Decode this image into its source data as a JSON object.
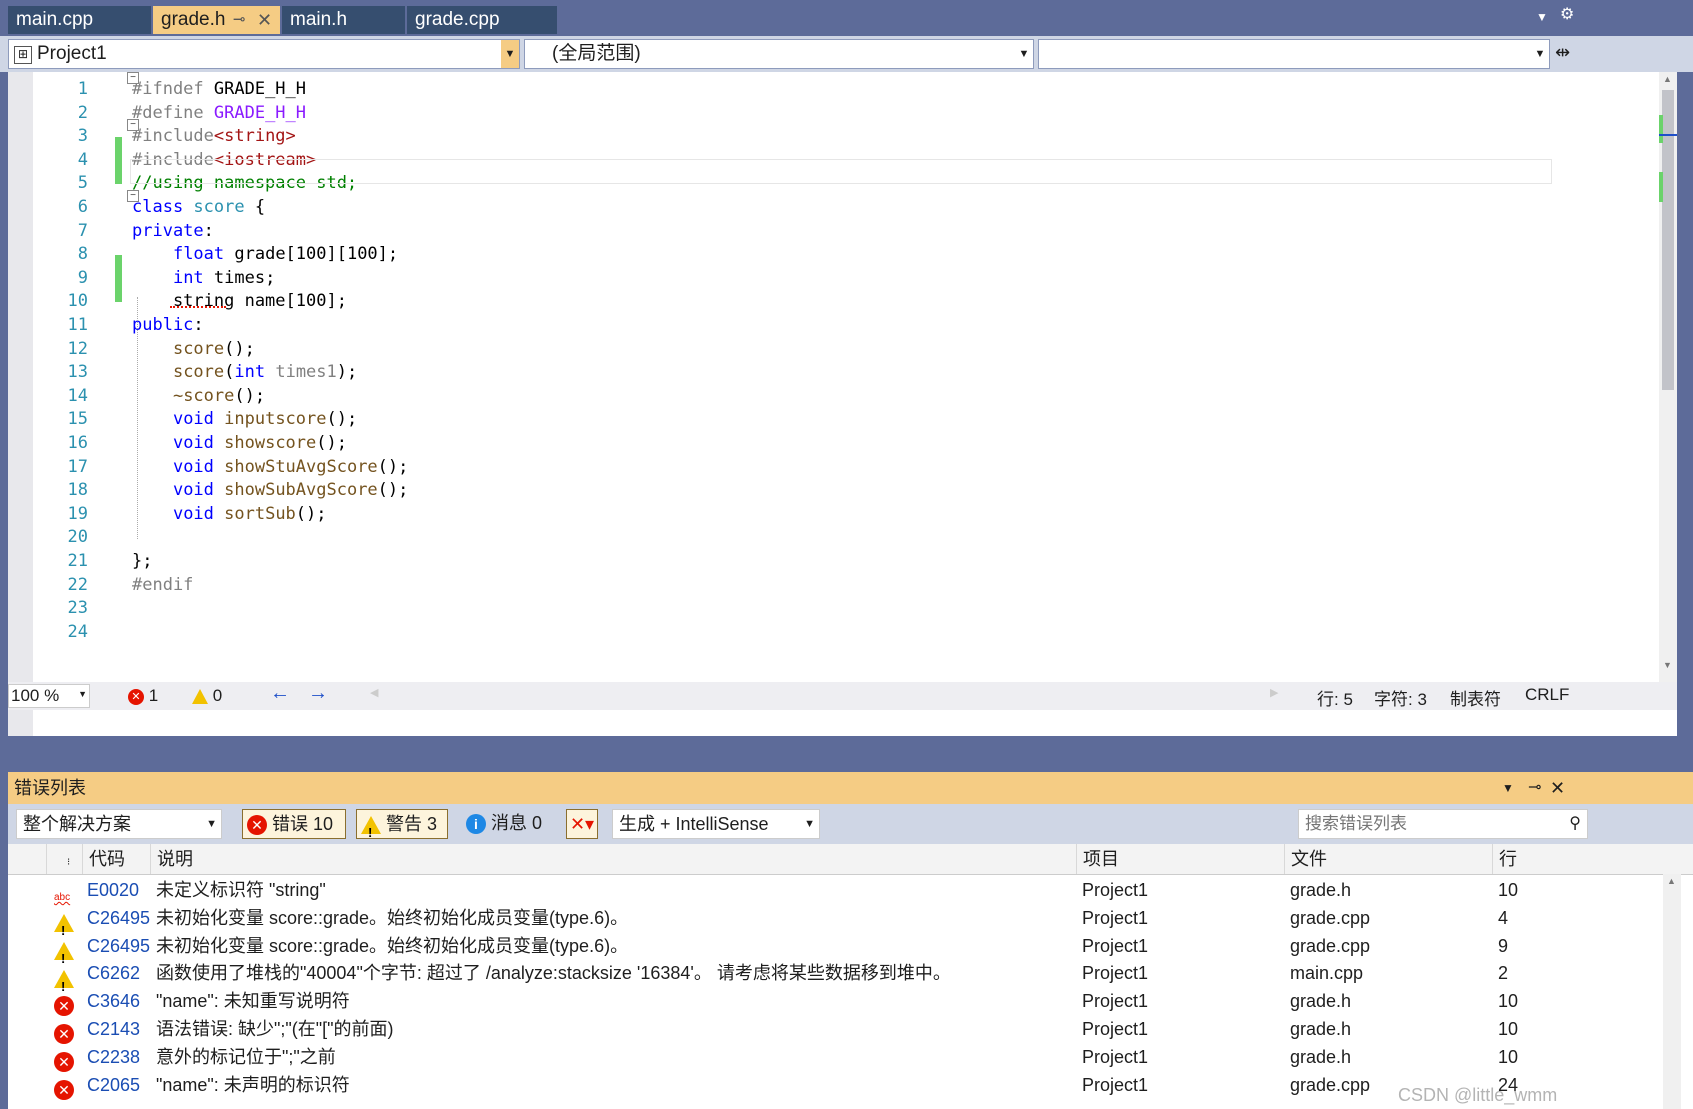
{
  "tabs": [
    {
      "label": "main.cpp"
    },
    {
      "label": "grade.h"
    },
    {
      "label": "main.h"
    },
    {
      "label": "grade.cpp"
    }
  ],
  "nav": {
    "project": "Project1",
    "scope": "(全局范围)"
  },
  "code_lines": [
    {
      "n": "1",
      "segs": [
        {
          "c": "pp",
          "t": "#ifndef "
        },
        {
          "c": "plain",
          "t": "GRADE_H_H"
        }
      ]
    },
    {
      "n": "2",
      "segs": [
        {
          "c": "pp",
          "t": "#define "
        },
        {
          "c": "mac",
          "t": "GRADE_H_H"
        }
      ]
    },
    {
      "n": "3",
      "segs": [
        {
          "c": "pp",
          "t": "#include"
        },
        {
          "c": "str",
          "t": "<string>"
        }
      ]
    },
    {
      "n": "4",
      "segs": [
        {
          "c": "pp",
          "t": "#include"
        },
        {
          "c": "str",
          "t": "<iostream>"
        }
      ]
    },
    {
      "n": "5",
      "segs": [
        {
          "c": "cm",
          "t": "//using namespace std;"
        }
      ]
    },
    {
      "n": "6",
      "segs": [
        {
          "c": "kw",
          "t": "class "
        },
        {
          "c": "ty",
          "t": "score"
        },
        {
          "c": "plain",
          "t": " {"
        }
      ]
    },
    {
      "n": "7",
      "segs": [
        {
          "c": "kw",
          "t": "private"
        },
        {
          "c": "plain",
          "t": ":"
        }
      ]
    },
    {
      "n": "8",
      "segs": [
        {
          "c": "plain",
          "t": "    "
        },
        {
          "c": "kw",
          "t": "float "
        },
        {
          "c": "plain",
          "t": "grade[100][100];"
        }
      ]
    },
    {
      "n": "9",
      "segs": [
        {
          "c": "plain",
          "t": "    "
        },
        {
          "c": "kw",
          "t": "int "
        },
        {
          "c": "plain",
          "t": "times;"
        }
      ]
    },
    {
      "n": "10",
      "segs": [
        {
          "c": "plain",
          "t": "    string name[100];"
        }
      ]
    },
    {
      "n": "11",
      "segs": [
        {
          "c": "kw",
          "t": "public"
        },
        {
          "c": "plain",
          "t": ":"
        }
      ]
    },
    {
      "n": "12",
      "segs": [
        {
          "c": "plain",
          "t": "    "
        },
        {
          "c": "fn",
          "t": "score"
        },
        {
          "c": "plain",
          "t": "();"
        }
      ]
    },
    {
      "n": "13",
      "segs": [
        {
          "c": "plain",
          "t": "    "
        },
        {
          "c": "fn",
          "t": "score"
        },
        {
          "c": "plain",
          "t": "("
        },
        {
          "c": "kw",
          "t": "int "
        },
        {
          "c": "par",
          "t": "times1"
        },
        {
          "c": "plain",
          "t": ");"
        }
      ]
    },
    {
      "n": "14",
      "segs": [
        {
          "c": "plain",
          "t": "    "
        },
        {
          "c": "fn",
          "t": "~score"
        },
        {
          "c": "plain",
          "t": "();"
        }
      ]
    },
    {
      "n": "15",
      "segs": [
        {
          "c": "plain",
          "t": "    "
        },
        {
          "c": "kw",
          "t": "void "
        },
        {
          "c": "fn",
          "t": "inputscore"
        },
        {
          "c": "plain",
          "t": "();"
        }
      ]
    },
    {
      "n": "16",
      "segs": [
        {
          "c": "plain",
          "t": "    "
        },
        {
          "c": "kw",
          "t": "void "
        },
        {
          "c": "fn",
          "t": "showscore"
        },
        {
          "c": "plain",
          "t": "();"
        }
      ]
    },
    {
      "n": "17",
      "segs": [
        {
          "c": "plain",
          "t": "    "
        },
        {
          "c": "kw",
          "t": "void "
        },
        {
          "c": "fn",
          "t": "showStuAvgScore"
        },
        {
          "c": "plain",
          "t": "();"
        }
      ]
    },
    {
      "n": "18",
      "segs": [
        {
          "c": "plain",
          "t": "    "
        },
        {
          "c": "kw",
          "t": "void "
        },
        {
          "c": "fn",
          "t": "showSubAvgScore"
        },
        {
          "c": "plain",
          "t": "();"
        }
      ]
    },
    {
      "n": "19",
      "segs": [
        {
          "c": "plain",
          "t": "    "
        },
        {
          "c": "kw",
          "t": "void "
        },
        {
          "c": "fn",
          "t": "sortSub"
        },
        {
          "c": "plain",
          "t": "();"
        }
      ]
    },
    {
      "n": "20",
      "segs": []
    },
    {
      "n": "21",
      "segs": [
        {
          "c": "plain",
          "t": "};"
        }
      ]
    },
    {
      "n": "22",
      "segs": [
        {
          "c": "pp",
          "t": "#endif"
        }
      ]
    },
    {
      "n": "23",
      "segs": []
    },
    {
      "n": "24",
      "segs": []
    }
  ],
  "editor_status": {
    "zoom": "100 %",
    "errors": "1",
    "warnings": "0",
    "row": "行: 5",
    "col": "字符: 3",
    "tabs": "制表符",
    "eol": "CRLF"
  },
  "error_list": {
    "title": "错误列表",
    "scope": "整个解决方案",
    "errors_btn": "错误 10",
    "warnings_btn": "警告 3",
    "messages_btn": "消息 0",
    "build_filter": "生成 + IntelliSense",
    "search_placeholder": "搜索错误列表",
    "headers": {
      "code": "代码",
      "desc": "说明",
      "project": "项目",
      "file": "文件",
      "line": "行"
    },
    "rows": [
      {
        "sev": "spell",
        "code": "E0020",
        "desc": "未定义标识符 \"string\"",
        "project": "Project1",
        "file": "grade.h",
        "line": "10"
      },
      {
        "sev": "warn",
        "code": "C26495",
        "desc": "未初始化变量 score::grade。始终初始化成员变量(type.6)。",
        "project": "Project1",
        "file": "grade.cpp",
        "line": "4"
      },
      {
        "sev": "warn",
        "code": "C26495",
        "desc": "未初始化变量 score::grade。始终初始化成员变量(type.6)。",
        "project": "Project1",
        "file": "grade.cpp",
        "line": "9"
      },
      {
        "sev": "warn",
        "code": "C6262",
        "desc": "函数使用了堆栈的\"40004\"个字节: 超过了 /analyze:stacksize '16384'。 请考虑将某些数据移到堆中。",
        "project": "Project1",
        "file": "main.cpp",
        "line": "2"
      },
      {
        "sev": "err",
        "code": "C3646",
        "desc": "\"name\": 未知重写说明符",
        "project": "Project1",
        "file": "grade.h",
        "line": "10"
      },
      {
        "sev": "err",
        "code": "C2143",
        "desc": "语法错误: 缺少\";\"(在\"[\"的前面)",
        "project": "Project1",
        "file": "grade.h",
        "line": "10"
      },
      {
        "sev": "err",
        "code": "C2238",
        "desc": "意外的标记位于\";\"之前",
        "project": "Project1",
        "file": "grade.h",
        "line": "10"
      },
      {
        "sev": "err",
        "code": "C2065",
        "desc": "\"name\": 未声明的标识符",
        "project": "Project1",
        "file": "grade.cpp",
        "line": "24"
      }
    ]
  },
  "watermark": "CSDN @little_wmm"
}
